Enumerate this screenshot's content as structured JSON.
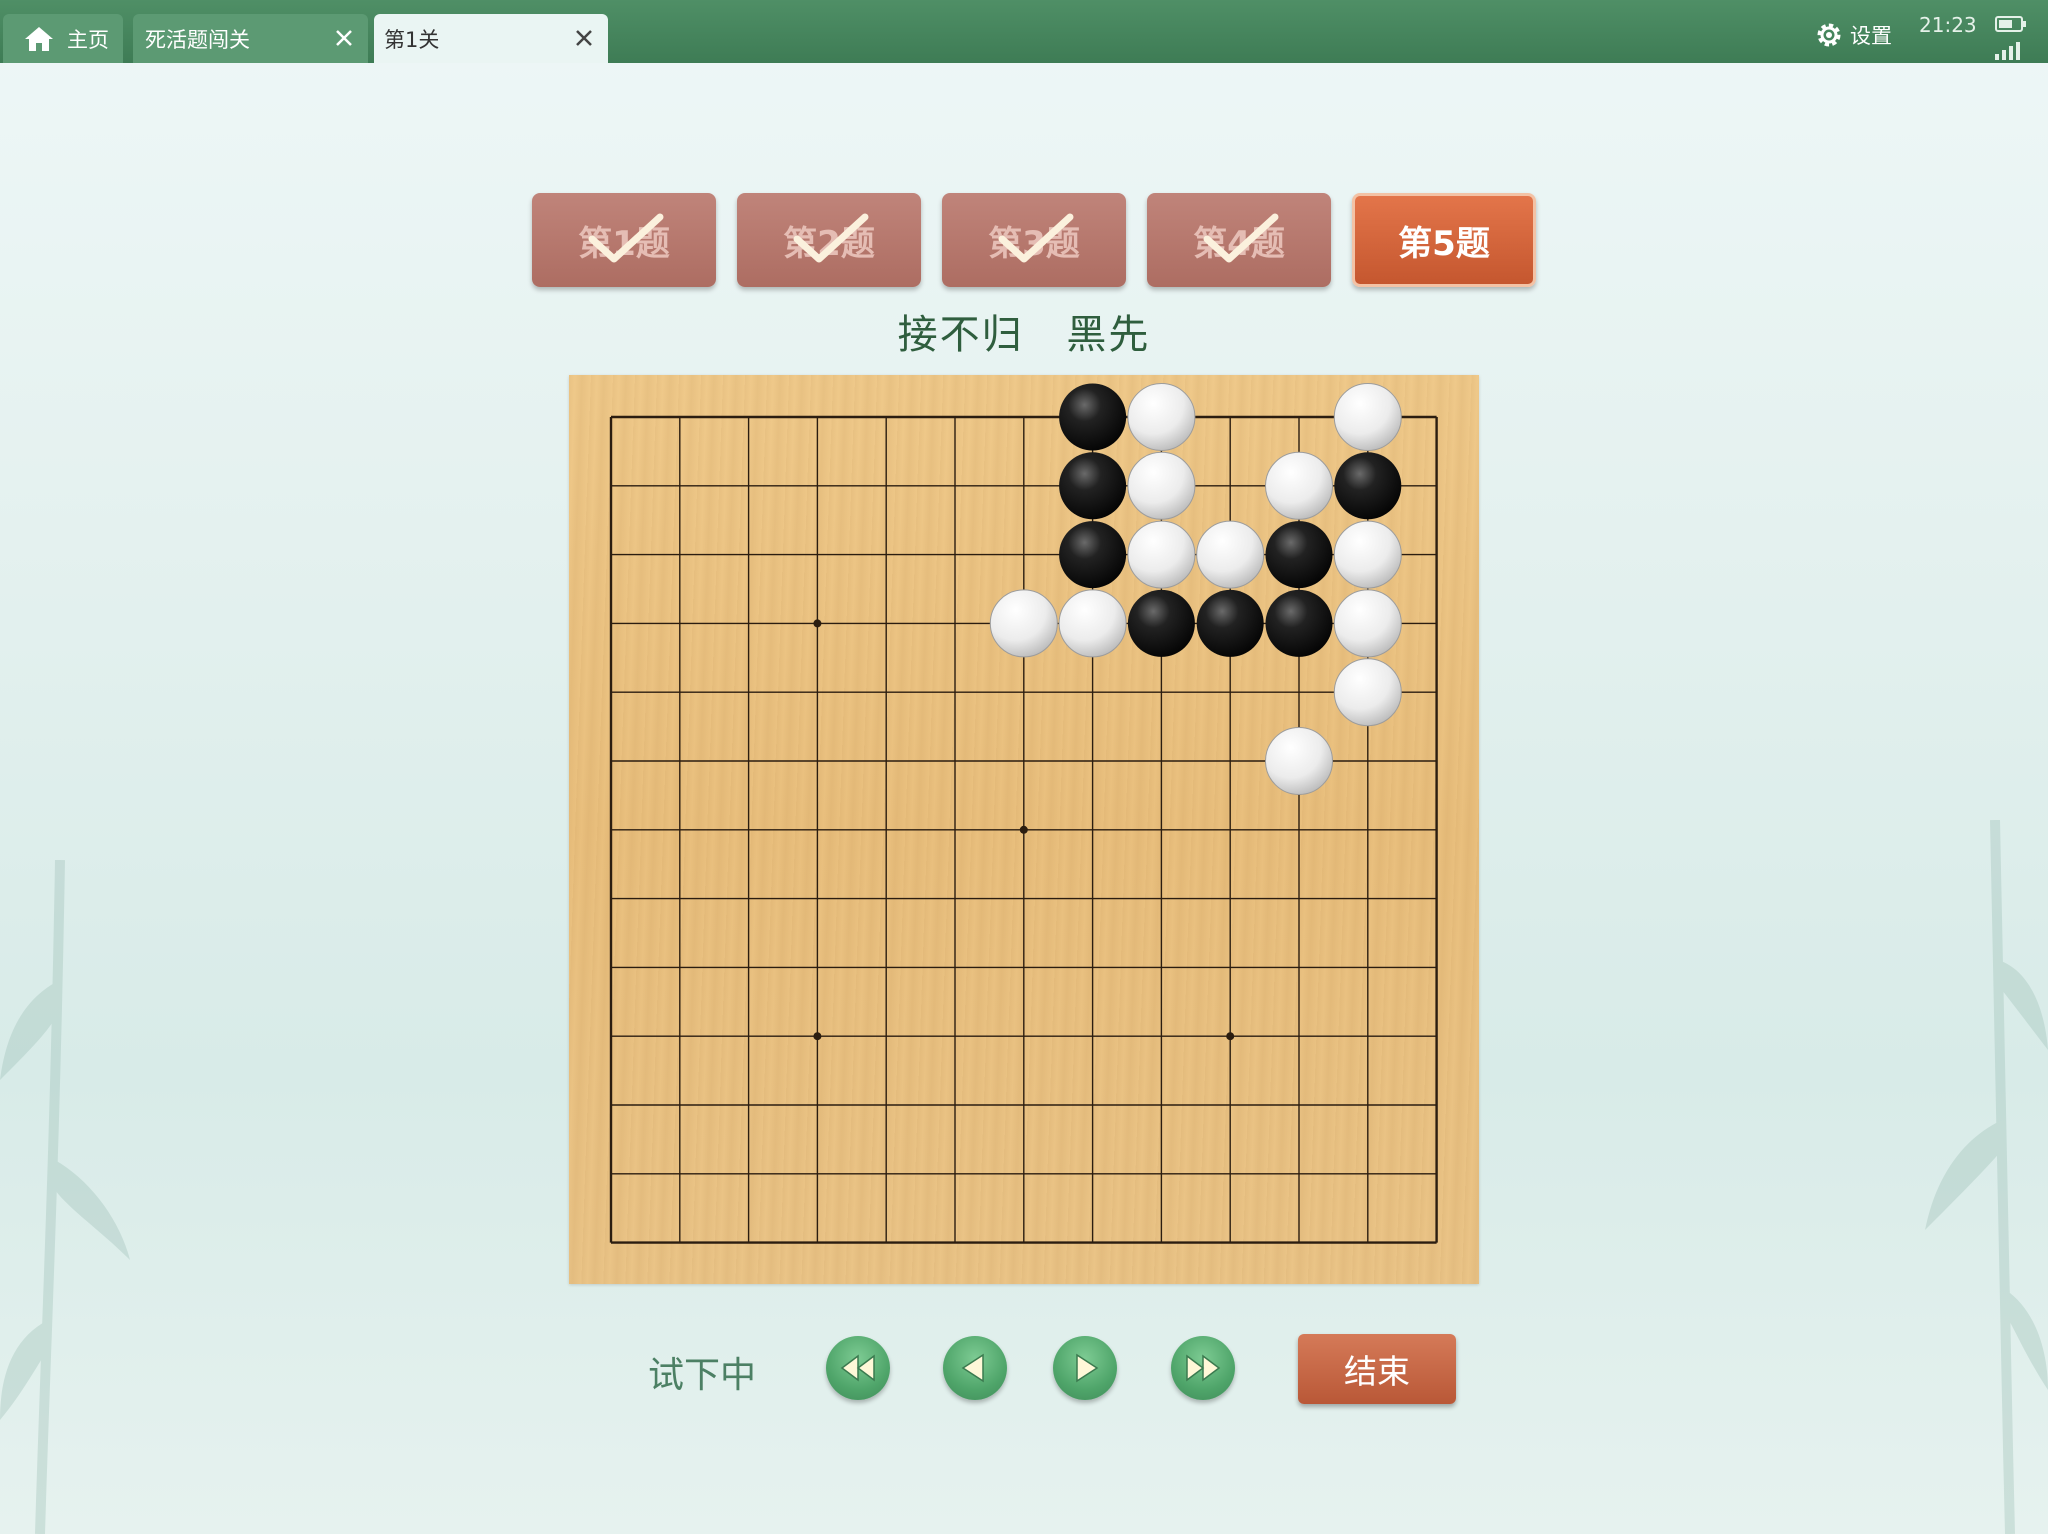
{
  "tabs": [
    {
      "label": "主页",
      "icon": "home-icon"
    },
    {
      "label": "死活题闯关",
      "icon": "close-icon"
    },
    {
      "label": "第1关",
      "icon": "close-icon",
      "active": true
    }
  ],
  "status": {
    "settings_label": "设置",
    "time": "21:23"
  },
  "problems": [
    {
      "label": "第1题",
      "solved": true
    },
    {
      "label": "第2题",
      "solved": true
    },
    {
      "label": "第3题",
      "solved": true
    },
    {
      "label": "第4题",
      "solved": true
    },
    {
      "label": "第5题",
      "solved": false,
      "current": true
    }
  ],
  "hint": {
    "technique": "接不归",
    "turn": "黑先"
  },
  "board": {
    "size": 13,
    "star_points": [
      [
        3,
        3
      ],
      [
        9,
        3
      ],
      [
        6,
        6
      ],
      [
        3,
        9
      ],
      [
        9,
        9
      ]
    ],
    "black": [
      [
        7,
        0
      ],
      [
        7,
        1
      ],
      [
        7,
        2
      ],
      [
        11,
        1
      ],
      [
        10,
        2
      ],
      [
        8,
        3
      ],
      [
        9,
        3
      ],
      [
        10,
        3
      ]
    ],
    "white": [
      [
        8,
        0
      ],
      [
        11,
        0
      ],
      [
        8,
        1
      ],
      [
        10,
        1
      ],
      [
        8,
        2
      ],
      [
        9,
        2
      ],
      [
        11,
        2
      ],
      [
        6,
        3
      ],
      [
        7,
        3
      ],
      [
        11,
        3
      ],
      [
        11,
        4
      ],
      [
        10,
        5
      ]
    ]
  },
  "controls": {
    "mode_label": "试下中",
    "nav": [
      "first-move-icon",
      "previous-move-icon",
      "next-move-icon",
      "last-move-icon"
    ],
    "end_label": "结束"
  },
  "colors": {
    "topbar": "#3e7c55",
    "current_problem": "#d0653d",
    "solved_problem": "#b8786d",
    "nav_button": "#4fa56a"
  }
}
